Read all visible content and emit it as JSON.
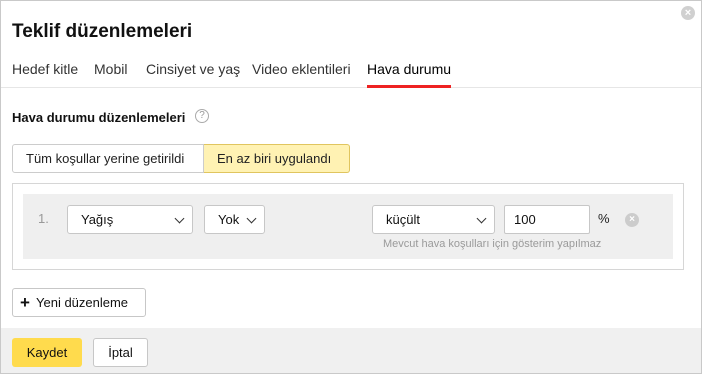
{
  "dialog": {
    "title": "Teklif düzenlemeleri",
    "close_icon": "close-icon"
  },
  "tabs": [
    {
      "label": "Hedef kitle",
      "active": false
    },
    {
      "label": "Mobil",
      "active": false
    },
    {
      "label": "Cinsiyet ve yaş",
      "active": false
    },
    {
      "label": "Video eklentileri",
      "active": false
    },
    {
      "label": "Hava durumu",
      "active": true
    }
  ],
  "section": {
    "label": "Hava durumu düzenlemeleri",
    "help_icon": "?"
  },
  "mode": {
    "options": [
      "Tüm koşullar yerine getirildi",
      "En az biri uygulandı"
    ],
    "selected": "En az biri uygulandı"
  },
  "rule": {
    "number": "1.",
    "condition": "Yağış",
    "value": "Yok",
    "direction": "küçült",
    "percent_value": "100",
    "percent_sign": "%",
    "hint": "Mevcut hava koşulları için gösterim yapılmaz"
  },
  "actions": {
    "add_label": "Yeni düzenleme",
    "save_label": "Kaydet",
    "cancel_label": "İptal"
  },
  "colors": {
    "accent": "#ffdb4d",
    "active_tab": "#ee2222",
    "selected_segment": "#fff2b3"
  }
}
